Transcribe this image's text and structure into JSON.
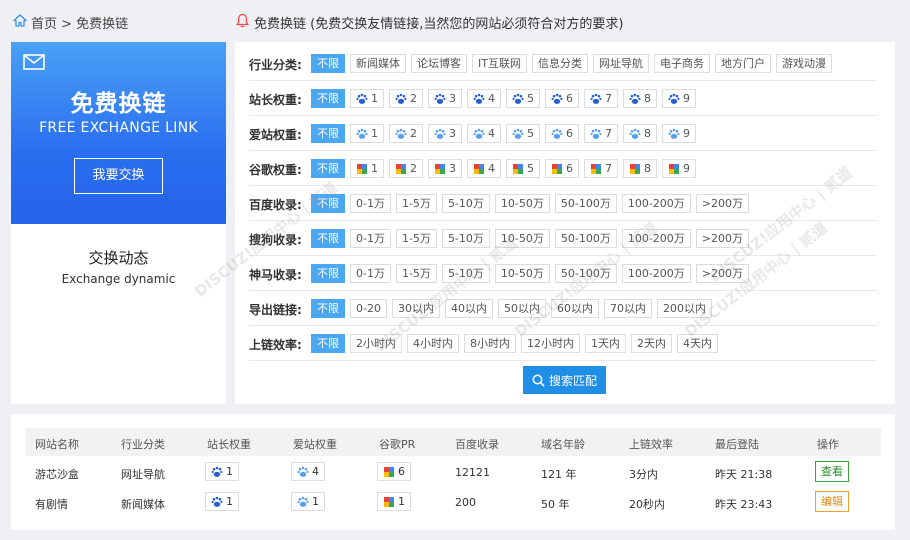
{
  "topbar": {
    "breadcrumb": "首页 > 免费换链",
    "notice": "免费换链 (免费交换友情链接,当然您的网站必须符合对方的要求)"
  },
  "hero": {
    "title": "免费换链",
    "subtitle": "FREE EXCHANGE LINK",
    "button": "我要交换"
  },
  "dynamic": {
    "title": "交换动态",
    "subtitle": "Exchange dynamic"
  },
  "filters": [
    {
      "label": "行业分类:",
      "icon": "",
      "options": [
        "不限",
        "新闻媒体",
        "论坛博客",
        "IT互联网",
        "信息分类",
        "网址导航",
        "电子商务",
        "地方门户",
        "游戏动漫"
      ]
    },
    {
      "label": "站长权重:",
      "icon": "paw-icon",
      "options": [
        "不限",
        "1",
        "2",
        "3",
        "4",
        "5",
        "6",
        "7",
        "8",
        "9"
      ]
    },
    {
      "label": "爱站权重:",
      "icon": "paw-light-icon",
      "options": [
        "不限",
        "1",
        "2",
        "3",
        "4",
        "5",
        "6",
        "7",
        "8",
        "9"
      ]
    },
    {
      "label": "谷歌权重:",
      "icon": "google-pr-icon",
      "options": [
        "不限",
        "1",
        "2",
        "3",
        "4",
        "5",
        "6",
        "7",
        "8",
        "9"
      ]
    },
    {
      "label": "百度收录:",
      "icon": "",
      "options": [
        "不限",
        "0-1万",
        "1-5万",
        "5-10万",
        "10-50万",
        "50-100万",
        "100-200万",
        ">200万"
      ]
    },
    {
      "label": "搜狗收录:",
      "icon": "",
      "options": [
        "不限",
        "0-1万",
        "1-5万",
        "5-10万",
        "10-50万",
        "50-100万",
        "100-200万",
        ">200万"
      ]
    },
    {
      "label": "神马收录:",
      "icon": "",
      "options": [
        "不限",
        "0-1万",
        "1-5万",
        "5-10万",
        "10-50万",
        "50-100万",
        "100-200万",
        ">200万"
      ]
    },
    {
      "label": "导出链接:",
      "icon": "",
      "options": [
        "不限",
        "0-20",
        "30以内",
        "40以内",
        "50以内",
        "60以内",
        "70以内",
        "200以内"
      ]
    },
    {
      "label": "上链效率:",
      "icon": "",
      "options": [
        "不限",
        "2小时内",
        "4小时内",
        "8小时内",
        "12小时内",
        "1天内",
        "2天内",
        "4天内"
      ]
    }
  ],
  "search_button": "搜索匹配",
  "table": {
    "headers": [
      "网站名称",
      "行业分类",
      "站长权重",
      "爱站权重",
      "谷歌PR",
      "百度收录",
      "域名年龄",
      "上链效率",
      "最后登陆",
      "操作"
    ],
    "rows": [
      {
        "name": "游芯沙盒",
        "category": "网址导航",
        "zz": "1",
        "az": "4",
        "pr": "6",
        "baidu": "12121",
        "age": "121 年",
        "eff": "3分内",
        "last": "昨天 21:38",
        "action": "查看",
        "action_type": "view"
      },
      {
        "name": "有剧情",
        "category": "新闻媒体",
        "zz": "1",
        "az": "1",
        "pr": "1",
        "baidu": "200",
        "age": "50 年",
        "eff": "20秒内",
        "last": "昨天 23:43",
        "action": "编辑",
        "action_type": "edit"
      }
    ]
  },
  "watermark": "DISCUZ!应用中心 | 贰道",
  "colors": {
    "accent": "#4ba7f2",
    "search": "#1f8ee6",
    "paw": "#2a5fcf",
    "paw_light": "#5aa0f0",
    "view": "#2e8f2e",
    "edit": "#e08a10"
  }
}
